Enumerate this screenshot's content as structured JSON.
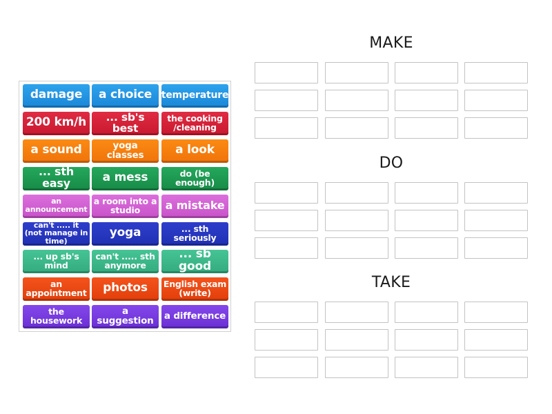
{
  "activity": {
    "type": "group-sort",
    "groups": [
      {
        "title": "MAKE",
        "slots": 12
      },
      {
        "title": "DO",
        "slots": 12
      },
      {
        "title": "TAKE",
        "slots": 12
      }
    ]
  },
  "tiles": [
    {
      "label": "damage",
      "color": "#2196e3"
    },
    {
      "label": "a choice",
      "color": "#2196e3"
    },
    {
      "label": "temperature",
      "color": "#2196e3"
    },
    {
      "label": "200 km/h",
      "color": "#d8213a"
    },
    {
      "label": "... sb's best",
      "color": "#d8213a"
    },
    {
      "label": "the cooking /cleaning",
      "color": "#d8213a"
    },
    {
      "label": "a sound",
      "color": "#f57f0e"
    },
    {
      "label": "yoga classes",
      "color": "#f57f0e"
    },
    {
      "label": "a look",
      "color": "#f57f0e"
    },
    {
      "label": "... sth easy",
      "color": "#1f9d55"
    },
    {
      "label": "a mess",
      "color": "#1f9d55"
    },
    {
      "label": "do (be enough)",
      "color": "#1f9d55"
    },
    {
      "label": "an announcement",
      "color": "#d260d3"
    },
    {
      "label": "a room into a studio",
      "color": "#d260d3"
    },
    {
      "label": "a mistake",
      "color": "#d260d3"
    },
    {
      "label": "can't ..... it (not manage in time)",
      "color": "#2837c0"
    },
    {
      "label": "yoga",
      "color": "#2837c0"
    },
    {
      "label": "... sth seriously",
      "color": "#2837c0"
    },
    {
      "label": "... up sb's mind",
      "color": "#3cb98a"
    },
    {
      "label": "can't ..... sth anymore",
      "color": "#3cb98a"
    },
    {
      "label": "... sb good",
      "color": "#3cb98a"
    },
    {
      "label": "an appointment",
      "color": "#ea4812"
    },
    {
      "label": "photos",
      "color": "#ea4812"
    },
    {
      "label": "English exam (write)",
      "color": "#ea4812"
    },
    {
      "label": "the housework",
      "color": "#773ce0"
    },
    {
      "label": "a suggestion",
      "color": "#773ce0"
    },
    {
      "label": "a difference",
      "color": "#773ce0"
    }
  ]
}
